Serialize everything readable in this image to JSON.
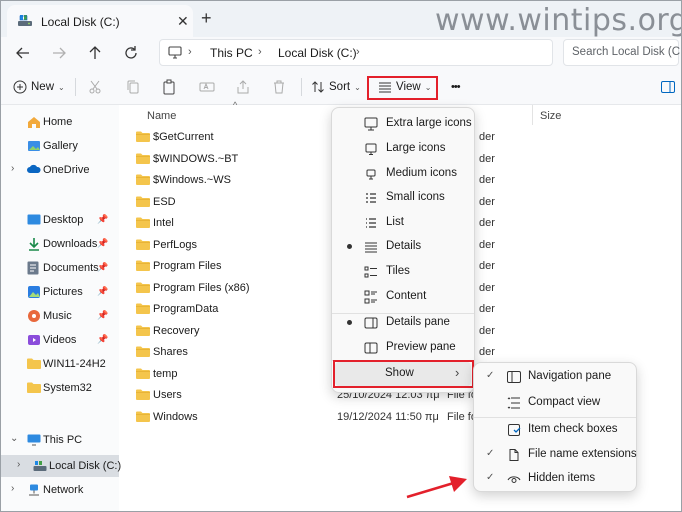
{
  "tab": {
    "title": "Local Disk (C:)",
    "close": "✕",
    "new_tab": "+"
  },
  "watermark": "www.wintips.org",
  "address": {
    "segments": [
      "This PC",
      "Local Disk (C:)"
    ]
  },
  "search": {
    "placeholder": "Search Local Disk (C:)"
  },
  "toolbar": {
    "new_label": "New",
    "sort_label": "Sort",
    "view_label": "View",
    "more_label": "•••"
  },
  "columns": {
    "name": "Name",
    "size": "Size"
  },
  "sidebar": {
    "home": "Home",
    "gallery": "Gallery",
    "onedrive": "OneDrive",
    "quick": [
      "Desktop",
      "Downloads",
      "Documents",
      "Pictures",
      "Music",
      "Videos",
      "WIN11-24H2",
      "System32"
    ],
    "this_pc": "This PC",
    "local_disk": "Local Disk (C:)",
    "network": "Network"
  },
  "files": [
    {
      "name": "$GetCurrent",
      "date": "",
      "type": "der"
    },
    {
      "name": "$WINDOWS.~BT",
      "date": "",
      "type": "der"
    },
    {
      "name": "$Windows.~WS",
      "date": "",
      "type": "der"
    },
    {
      "name": "ESD",
      "date": "",
      "type": "der"
    },
    {
      "name": "Intel",
      "date": "",
      "type": "der"
    },
    {
      "name": "PerfLogs",
      "date": "",
      "type": "der"
    },
    {
      "name": "Program Files",
      "date": "",
      "type": "der"
    },
    {
      "name": "Program Files (x86)",
      "date": "",
      "type": "der"
    },
    {
      "name": "ProgramData",
      "date": "",
      "type": "der"
    },
    {
      "name": "Recovery",
      "date": "",
      "type": "der"
    },
    {
      "name": "Shares",
      "date": "",
      "type": "der"
    },
    {
      "name": "temp",
      "date": "",
      "type": "der"
    },
    {
      "name": "Users",
      "date": "25/10/2024 12:03 πμ",
      "type": "File fo"
    },
    {
      "name": "Windows",
      "date": "19/12/2024 11:50 πμ",
      "type": "File fo"
    }
  ],
  "view_menu": {
    "items": [
      "Extra large icons",
      "Large icons",
      "Medium icons",
      "Small icons",
      "List",
      "Details",
      "Tiles",
      "Content"
    ],
    "panes": [
      "Details pane",
      "Preview pane"
    ],
    "show": "Show",
    "show_arrow": "›"
  },
  "show_menu": {
    "items": [
      "Navigation pane",
      "Compact view",
      "Item check boxes",
      "File name extensions",
      "Hidden items"
    ],
    "checked": [
      "✓",
      "",
      "",
      "✓",
      "✓"
    ]
  },
  "colors": {
    "highlight": "#e3202b",
    "folder": "#f4c54c",
    "accent": "#0067c0"
  }
}
